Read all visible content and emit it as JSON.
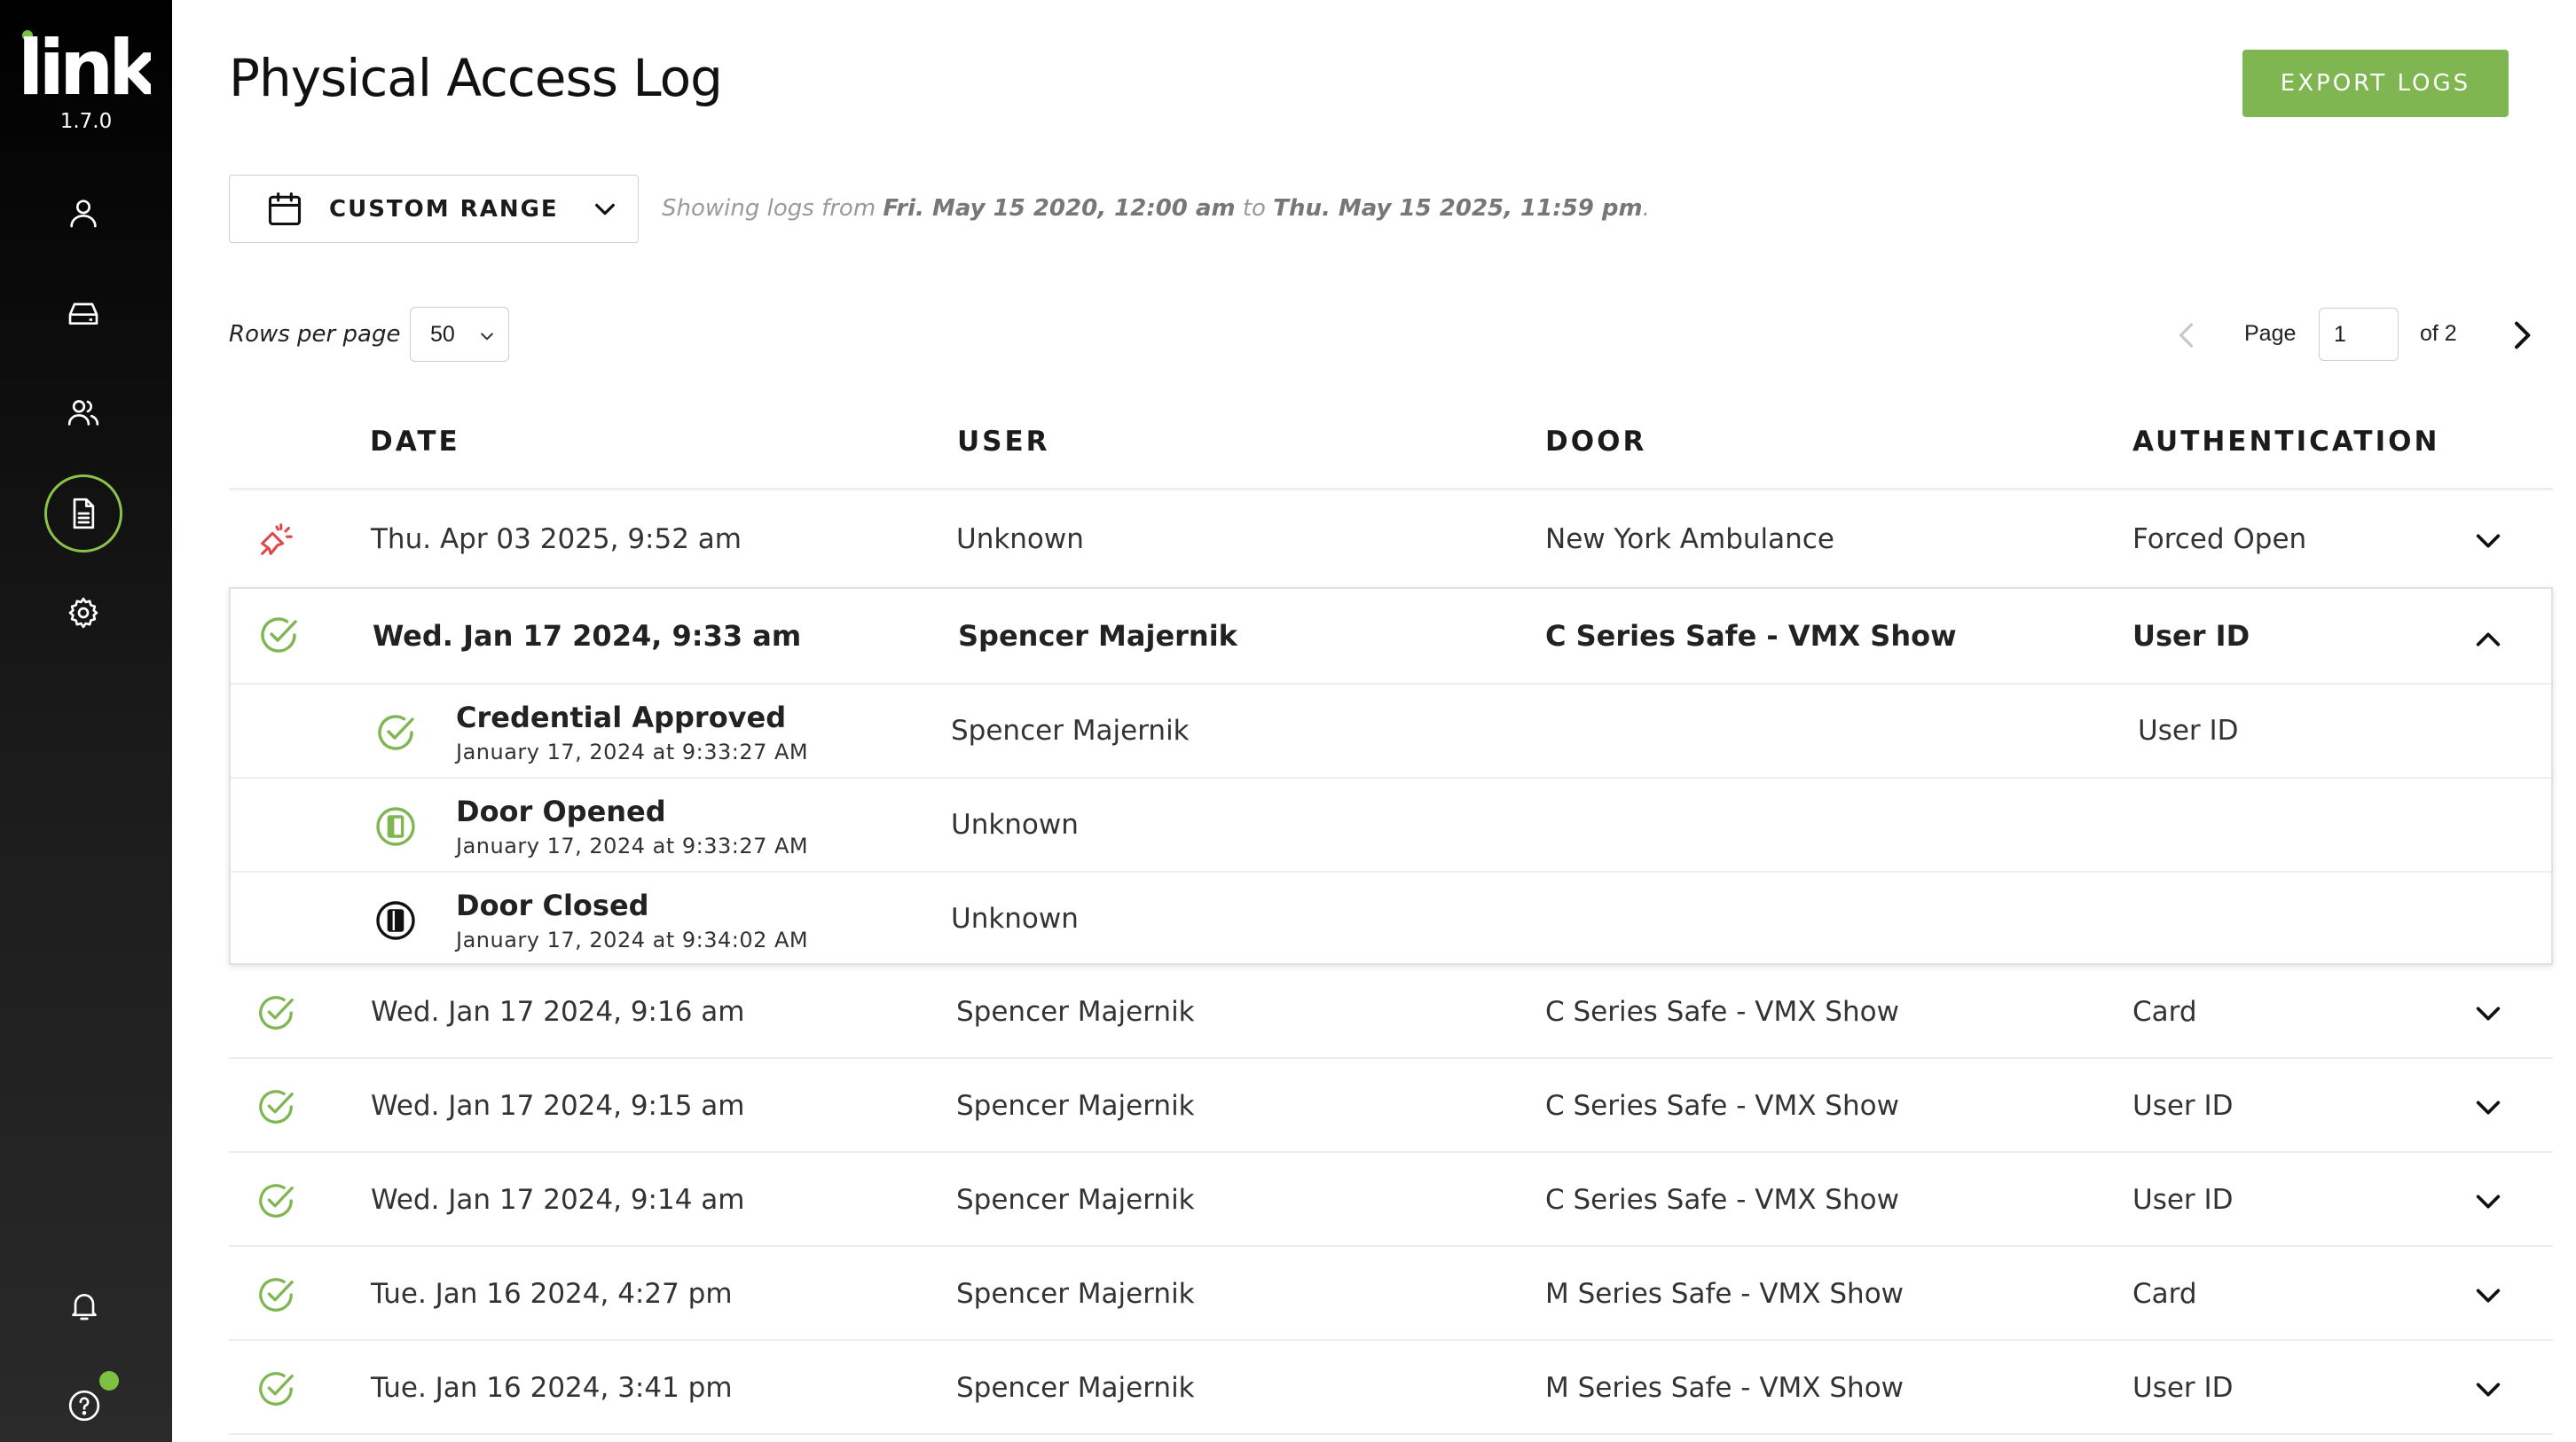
{
  "app": {
    "logo_text": "link",
    "version": "1.7.0"
  },
  "colors": {
    "accent": "#7fb651",
    "alert": "#e04848",
    "sidebar": "#000000"
  },
  "sidebar": {
    "items": [
      {
        "name": "user-icon",
        "active": false
      },
      {
        "name": "device-icon",
        "active": false
      },
      {
        "name": "users-icon",
        "active": false
      },
      {
        "name": "logs-icon",
        "active": true
      },
      {
        "name": "gear-icon",
        "active": false
      }
    ],
    "bottom": [
      "bell-icon",
      "help-icon"
    ]
  },
  "header": {
    "title": "Physical Access Log",
    "export_label": "EXPORT LOGS"
  },
  "filter": {
    "range_label": "CUSTOM RANGE",
    "showing_prefix": "Showing logs from",
    "from": "Fri. May 15 2020, 12:00 am",
    "to_word": "to",
    "to": "Thu. May 15 2025, 11:59 pm",
    "period": "."
  },
  "pagination": {
    "rows_label": "Rows per page",
    "rows_value": "50",
    "page_label": "Page",
    "page_value": "1",
    "of_label": "of 2"
  },
  "table": {
    "headers": {
      "date": "DATE",
      "user": "USER",
      "door": "DOOR",
      "auth": "AUTHENTICATION"
    },
    "first_row": {
      "status": "forced-open",
      "date": "Thu. Apr 03 2025, 9:52 am",
      "user": "Unknown",
      "door": "New York Ambulance",
      "auth": "Forced Open"
    },
    "expanded_row": {
      "status": "approved",
      "date": "Wed. Jan 17 2024, 9:33 am",
      "user": "Spencer Majernik",
      "door": "C Series Safe - VMX Show",
      "auth": "User ID",
      "events": [
        {
          "icon": "credential-approved",
          "title": "Credential Approved",
          "time": "January 17, 2024 at 9:33:27 AM",
          "user": "Spencer Majernik",
          "auth": "User ID"
        },
        {
          "icon": "door-opened",
          "title": "Door Opened",
          "time": "January 17, 2024 at 9:33:27 AM",
          "user": "Unknown",
          "auth": ""
        },
        {
          "icon": "door-closed",
          "title": "Door Closed",
          "time": "January 17, 2024 at 9:34:02 AM",
          "user": "Unknown",
          "auth": ""
        }
      ]
    },
    "rows": [
      {
        "status": "approved",
        "date": "Wed. Jan 17 2024, 9:16 am",
        "user": "Spencer Majernik",
        "door": "C Series Safe - VMX Show",
        "auth": "Card"
      },
      {
        "status": "approved",
        "date": "Wed. Jan 17 2024, 9:15 am",
        "user": "Spencer Majernik",
        "door": "C Series Safe - VMX Show",
        "auth": "User ID"
      },
      {
        "status": "approved",
        "date": "Wed. Jan 17 2024, 9:14 am",
        "user": "Spencer Majernik",
        "door": "C Series Safe - VMX Show",
        "auth": "User ID"
      },
      {
        "status": "approved",
        "date": "Tue. Jan 16 2024, 4:27 pm",
        "user": "Spencer Majernik",
        "door": "M Series Safe - VMX Show",
        "auth": "Card"
      },
      {
        "status": "approved",
        "date": "Tue. Jan 16 2024, 3:41 pm",
        "user": "Spencer Majernik",
        "door": "M Series Safe - VMX Show",
        "auth": "User ID"
      }
    ]
  }
}
